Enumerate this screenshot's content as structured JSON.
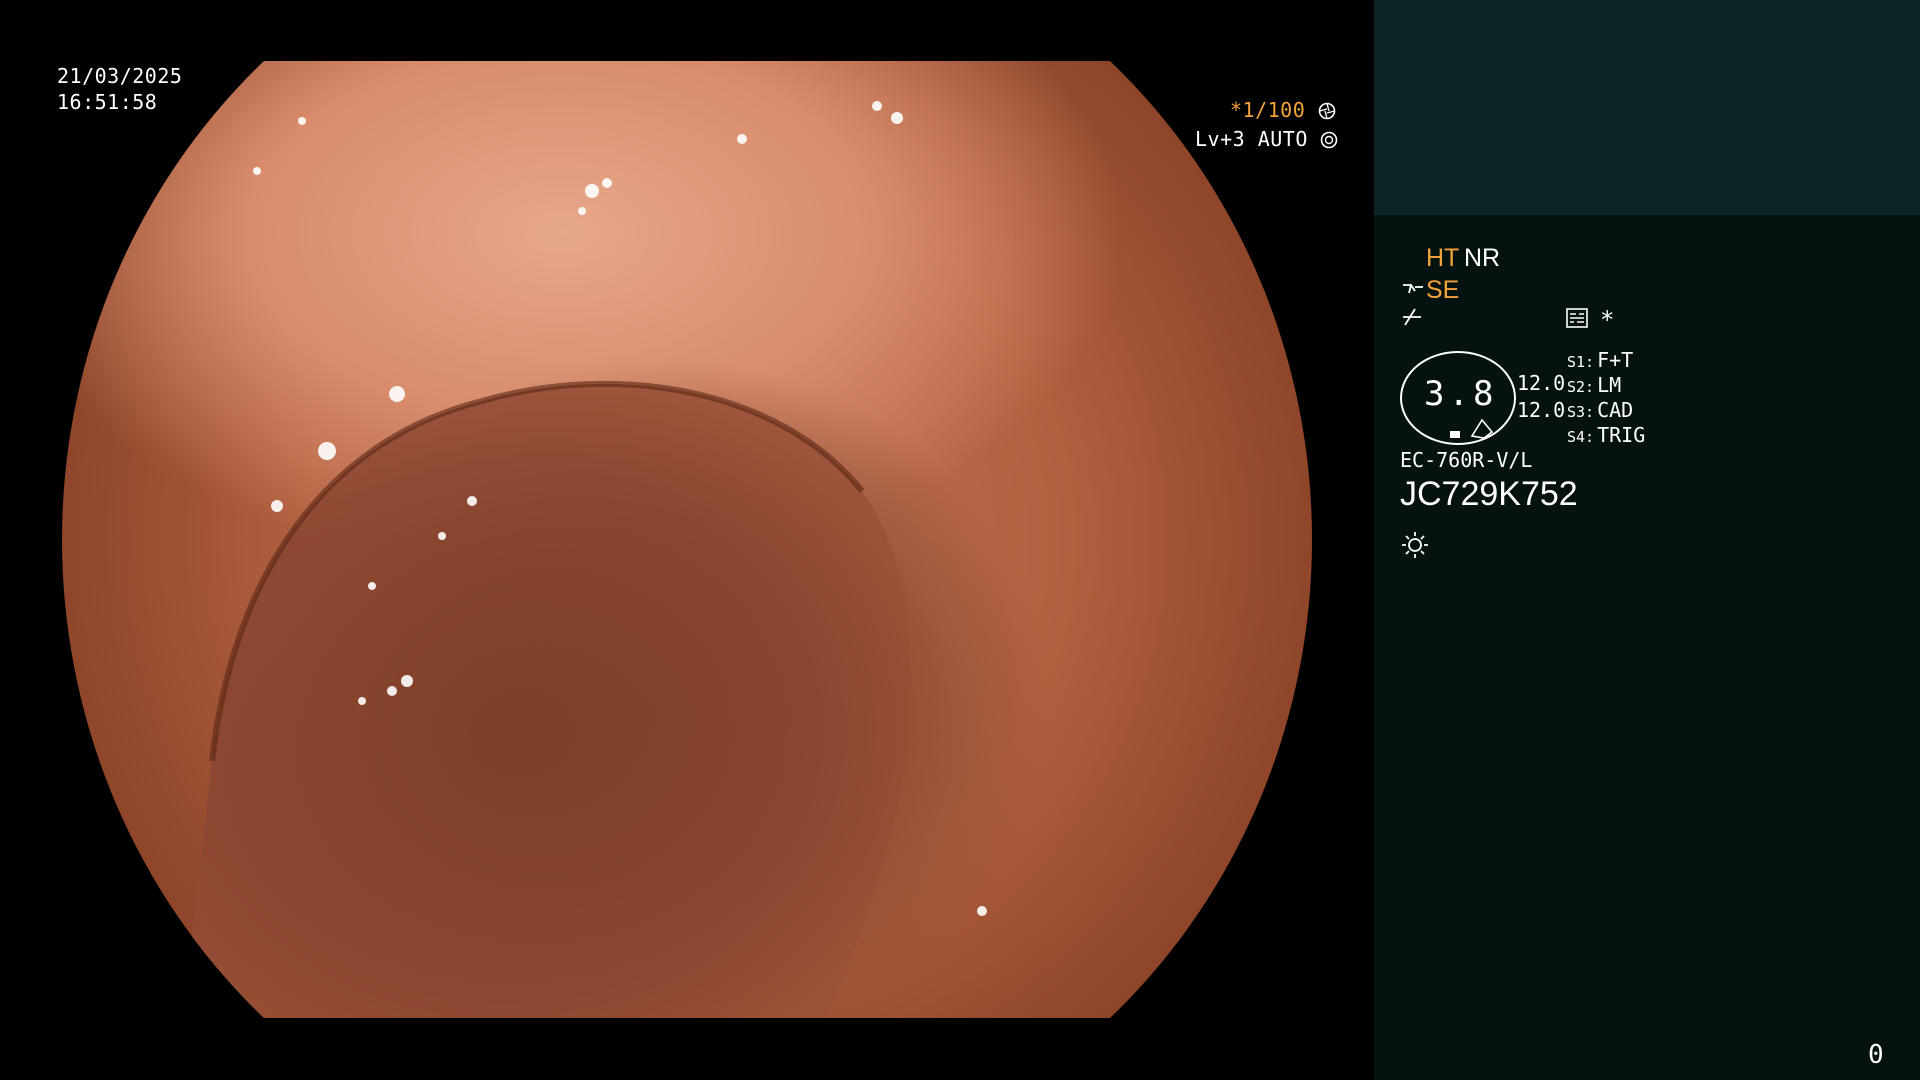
{
  "overlay": {
    "date": "21/03/2025",
    "time": "16:51:58",
    "shutter": "*1/100",
    "shutter_icon": "aperture-icon",
    "level": "Lv+3 AUTO",
    "level_icon": "iris-icon"
  },
  "panel": {
    "ht": "HT",
    "nr": "NR",
    "se": "SE",
    "zoom_value": "3.8",
    "value_1": "12.0",
    "value_2": "12.0",
    "switches": [
      {
        "key": "S1:",
        "value": "F+T"
      },
      {
        "key": "S2:",
        "value": "LM"
      },
      {
        "key": "S3:",
        "value": "CAD"
      },
      {
        "key": "S4:",
        "value": "TRIG"
      }
    ],
    "star": "*",
    "model": "EC-760R-V/L",
    "serial": "JC729K752",
    "counter": "0"
  },
  "colors": {
    "accent_orange": "#f2a33a",
    "panel_top": "#0d2426",
    "panel_main": "#051210",
    "mucosa": "#c4785a"
  },
  "icons": [
    "aperture-icon",
    "iris-icon",
    "hook-icon",
    "enhancement-icon",
    "camera-settings-icon",
    "light-source-icon"
  ]
}
